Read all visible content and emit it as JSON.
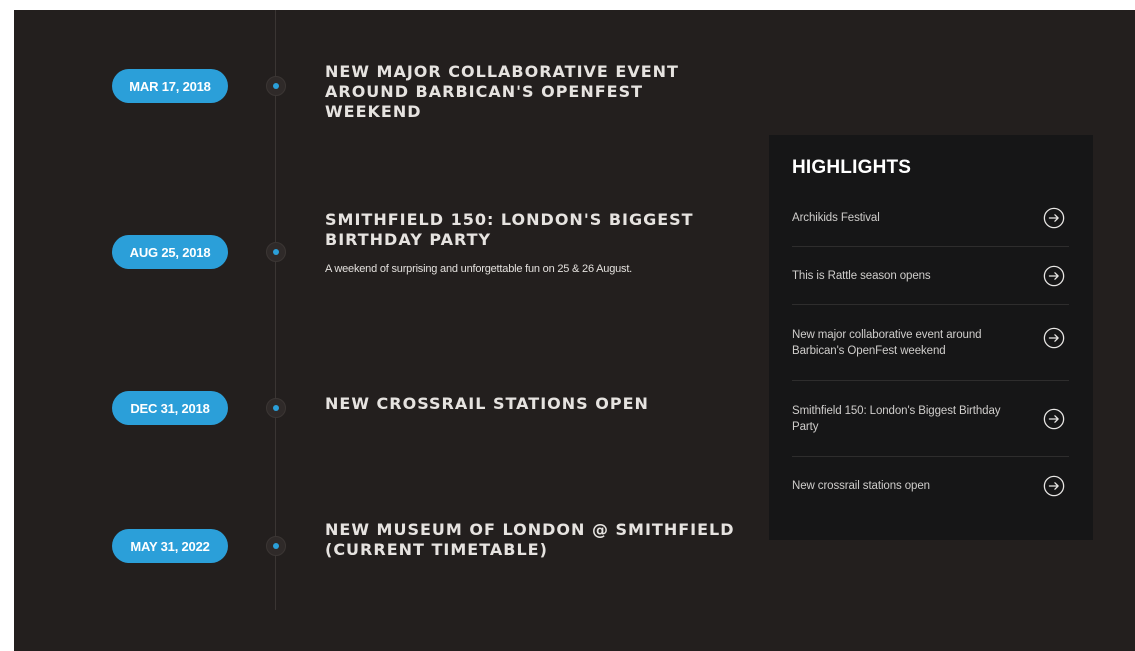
{
  "timeline": {
    "events": [
      {
        "date": "MAR 17, 2018",
        "title": "NEW MAJOR COLLABORATIVE EVENT AROUND BARBICAN'S OPENFEST WEEKEND",
        "description": ""
      },
      {
        "date": "AUG 25, 2018",
        "title": "SMITHFIELD 150: LONDON'S BIGGEST BIRTHDAY PARTY",
        "description": "A weekend of surprising and unforgettable fun on 25 & 26 August."
      },
      {
        "date": "DEC 31, 2018",
        "title": "NEW CROSSRAIL STATIONS OPEN",
        "description": ""
      },
      {
        "date": "MAY 31, 2022",
        "title": "NEW MUSEUM OF LONDON @ SMITHFIELD (CURRENT TIMETABLE)",
        "description": ""
      }
    ]
  },
  "highlights": {
    "title": "HIGHLIGHTS",
    "items": [
      {
        "label": "Archikids Festival",
        "icon": "arrow-right-circle-icon"
      },
      {
        "label": "This is Rattle season opens",
        "icon": "arrow-right-circle-icon"
      },
      {
        "label": "New major collaborative event around Barbican's OpenFest weekend",
        "icon": "arrow-right-circle-icon"
      },
      {
        "label": "Smithfield 150: London's Biggest Birthday Party",
        "icon": "arrow-right-circle-icon"
      },
      {
        "label": "New crossrail stations open",
        "icon": "arrow-right-circle-icon"
      }
    ]
  },
  "colors": {
    "background": "#231f1e",
    "accent": "#2b9fd9",
    "panel": "#161617"
  }
}
